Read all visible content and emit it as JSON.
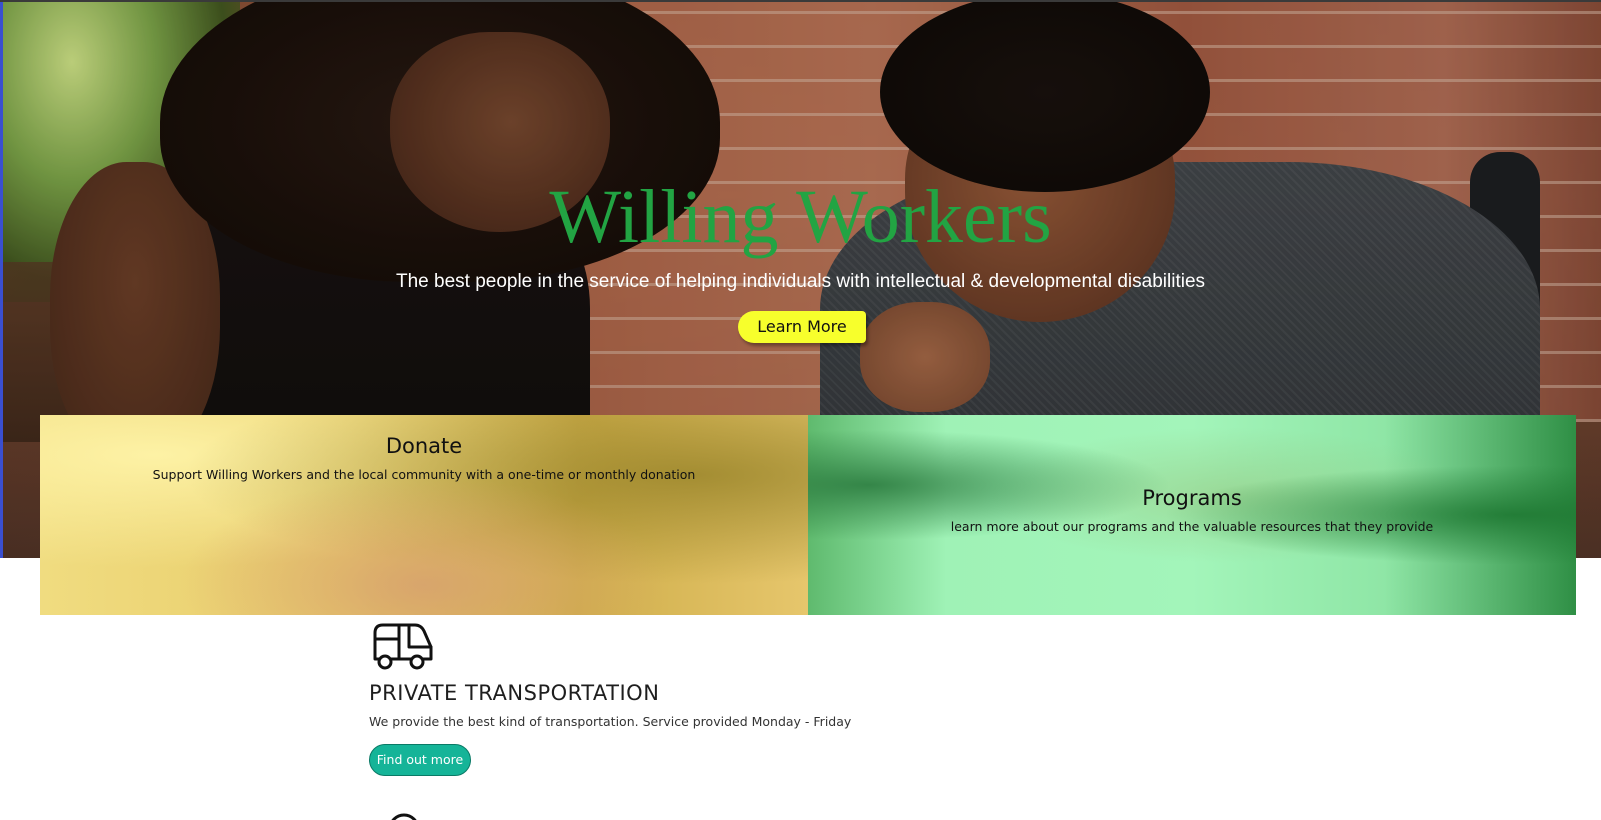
{
  "hero": {
    "title": "Willing Workers",
    "subtitle": "The best people in the service of helping individuals with intellectual & developmental disabilities",
    "cta_label": "Learn More",
    "title_color": "#22a443",
    "cta_color": "#f7ff2c"
  },
  "cards": [
    {
      "title": "Donate",
      "description": "Support Willing Workers and the local community with a one-time or monthly donation",
      "tint": "#e8cc6a"
    },
    {
      "title": "Programs",
      "description": "learn more about our programs and the valuable resources that they provide",
      "tint": "#a3f5ba"
    }
  ],
  "service": {
    "icon": "bus-icon",
    "title": "PRIVATE TRANSPORTATION",
    "description": "We provide the best kind of transportation. Service provided Monday - Friday",
    "button_label": "Find out more",
    "button_color": "#15b498"
  },
  "next_service": {
    "icon": "partial-icon"
  }
}
